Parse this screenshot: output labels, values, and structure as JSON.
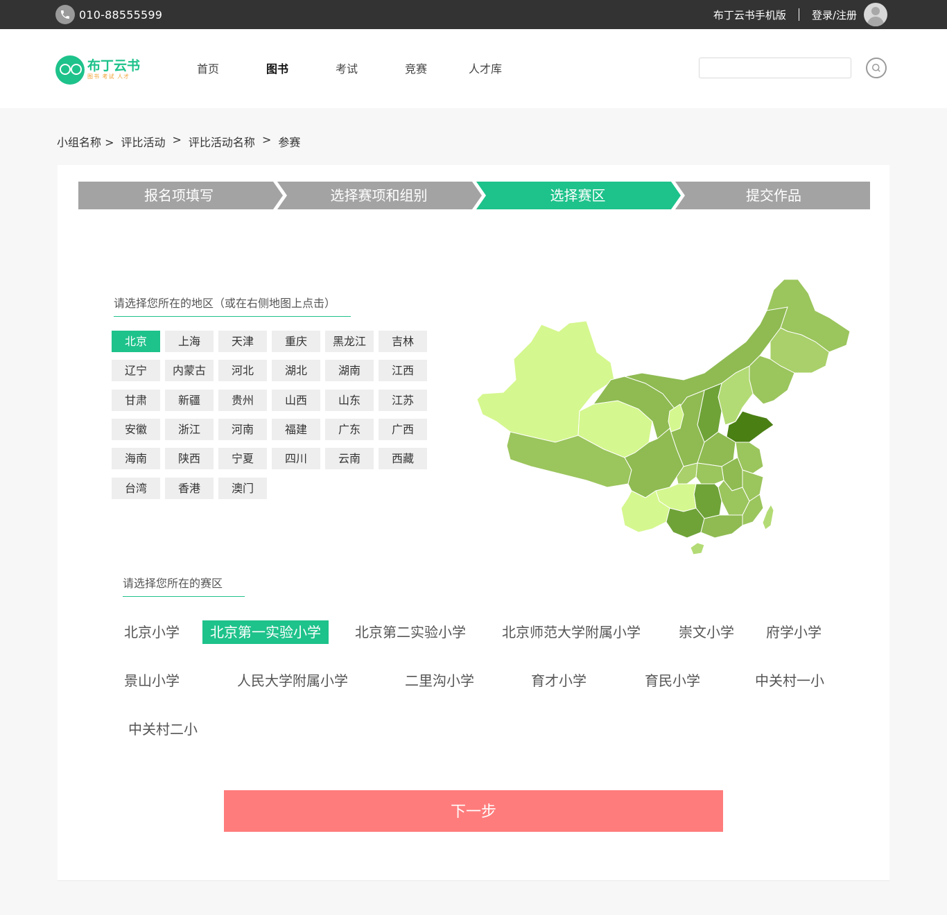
{
  "topbar": {
    "phone": "010-88555599",
    "mobile_version": "布丁云书手机版",
    "login": "登录/注册"
  },
  "header": {
    "logo_title": "布丁云书",
    "logo_sub": "图书 考试 人才",
    "nav": [
      "首页",
      "图书",
      "考试",
      "竞赛",
      "人才库"
    ],
    "nav_active": "图书",
    "search_placeholder": ""
  },
  "breadcrumb": {
    "items": [
      "小组名称 >",
      "评比活动",
      ">",
      "评比活动名称",
      ">",
      "参赛"
    ]
  },
  "steps": {
    "items": [
      "报名项填写",
      "选择赛项和组别",
      "选择赛区",
      "提交作品"
    ],
    "active_index": 2,
    "active_color": "#1ec28b",
    "inactive_color": "#a3a3a3"
  },
  "regions": {
    "title": "请选择您所在的地区（或在右侧地图上点击）",
    "items": [
      "北京",
      "上海",
      "天津",
      "重庆",
      "黑龙江",
      "吉林",
      "辽宁",
      "内蒙古",
      "河北",
      "湖北",
      "湖南",
      "江西",
      "甘肃",
      "新疆",
      "贵州",
      "山西",
      "山东",
      "江苏",
      "安徽",
      "浙江",
      "河南",
      "福建",
      "广东",
      "广西",
      "海南",
      "陕西",
      "宁夏",
      "四川",
      "云南",
      "西藏",
      "台湾",
      "香港",
      "澳门"
    ],
    "selected": "北京"
  },
  "zones": {
    "title": "请选择您所在的赛区",
    "items": [
      "北京小学",
      "北京第一实验小学",
      "北京第二实验小学",
      "北京师范大学附属小学",
      "崇文小学",
      "府学小学",
      "景山小学",
      "人民大学附属小学",
      "二里沟小学",
      "育才小学",
      "育民小学",
      "中关村一小",
      "中关村二小"
    ],
    "selected": "北京第一实验小学"
  },
  "next_button": "下一步",
  "colors": {
    "accent": "#1ec28b",
    "next_button": "#ff7c7c",
    "topbar": "#333333"
  }
}
